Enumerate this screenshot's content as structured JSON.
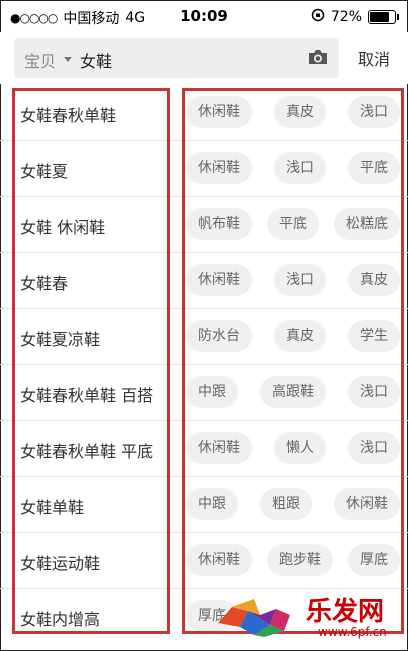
{
  "status_bar": {
    "carrier": "中国移动",
    "network": "4G",
    "time": "10:09",
    "battery": "72%",
    "signal_dots": "●○○○○"
  },
  "search": {
    "category": "宝贝",
    "query": "女鞋",
    "cancel": "取消",
    "camera_icon": "camera-icon"
  },
  "rows": [
    {
      "suggestion": "女鞋春秋单鞋",
      "tags": [
        "休闲鞋",
        "真皮",
        "浅口"
      ]
    },
    {
      "suggestion": "女鞋夏",
      "tags": [
        "休闲鞋",
        "浅口",
        "平底"
      ]
    },
    {
      "suggestion": "女鞋 休闲鞋",
      "tags": [
        "帆布鞋",
        "平底",
        "松糕底"
      ]
    },
    {
      "suggestion": "女鞋春",
      "tags": [
        "休闲鞋",
        "浅口",
        "真皮"
      ]
    },
    {
      "suggestion": "女鞋夏凉鞋",
      "tags": [
        "防水台",
        "真皮",
        "学生"
      ]
    },
    {
      "suggestion": "女鞋春秋单鞋 百搭",
      "tags": [
        "中跟",
        "高跟鞋",
        "浅口"
      ]
    },
    {
      "suggestion": "女鞋春秋单鞋 平底",
      "tags": [
        "休闲鞋",
        "懒人",
        "浅口"
      ]
    },
    {
      "suggestion": "女鞋单鞋",
      "tags": [
        "中跟",
        "粗跟",
        "休闲鞋"
      ]
    },
    {
      "suggestion": "女鞋运动鞋",
      "tags": [
        "休闲鞋",
        "跑步鞋",
        "厚底"
      ]
    },
    {
      "suggestion": "女鞋内增高",
      "tags": [
        "厚底",
        "",
        ""
      ]
    }
  ],
  "watermark": {
    "name": "乐发网",
    "url": "www.6pf.cn"
  },
  "colors": {
    "highlight": "#cc3333",
    "tag_bg": "#f0f0f0",
    "search_bg": "#eeeeee"
  }
}
